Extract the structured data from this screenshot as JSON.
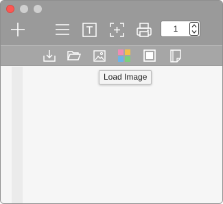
{
  "window": {
    "traffic_lights": [
      "close",
      "minimize",
      "maximize"
    ]
  },
  "toolbar": {
    "buttons": [
      {
        "name": "add",
        "icon": "plus-icon"
      },
      {
        "name": "list",
        "icon": "list-icon"
      },
      {
        "name": "text",
        "icon": "text-box-icon"
      },
      {
        "name": "crop",
        "icon": "crosshair-frame-icon"
      },
      {
        "name": "print",
        "icon": "printer-icon"
      }
    ],
    "page_number": "1"
  },
  "secondary_toolbar": {
    "buttons": [
      {
        "name": "download",
        "icon": "download-tray-icon"
      },
      {
        "name": "open-folder",
        "icon": "folder-icon"
      },
      {
        "name": "image",
        "icon": "image-icon"
      },
      {
        "name": "load-image",
        "icon": "color-grid-icon"
      },
      {
        "name": "frame",
        "icon": "square-frame-icon"
      },
      {
        "name": "page",
        "icon": "page-icon"
      }
    ]
  },
  "tooltip": {
    "text": "Load Image"
  },
  "colors": {
    "toolbar_bg": "#9a9a9a",
    "secondary_toolbar_bg": "#a6a6a6",
    "content_bg": "#f6f6f6",
    "icon_stroke": "#ffffff",
    "close_red": "#fc5753",
    "grid_pink": "#f08cb4",
    "grid_yellow": "#f5c04a",
    "grid_blue": "#6cb3ea",
    "grid_green": "#7bd17b"
  }
}
